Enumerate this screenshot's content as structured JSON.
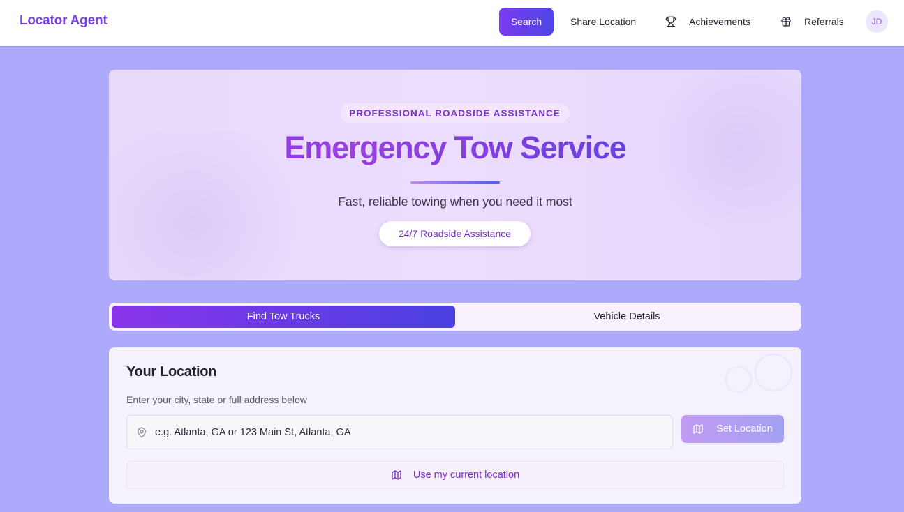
{
  "header": {
    "brand": "Locator Agent",
    "nav": {
      "search": "Search",
      "share_location": "Share Location",
      "achievements": "Achievements",
      "referrals": "Referrals"
    },
    "avatar_initials": "JD"
  },
  "hero": {
    "eyebrow": "PROFESSIONAL ROADSIDE ASSISTANCE",
    "title": "Emergency Tow Service",
    "subtitle": "Fast, reliable towing when you need it most",
    "badge": "24/7 Roadside Assistance"
  },
  "tabs": [
    {
      "label": "Find Tow Trucks",
      "active": true
    },
    {
      "label": "Vehicle Details",
      "active": false
    }
  ],
  "location_card": {
    "title": "Your Location",
    "help": "Enter your city, state or full address below",
    "input_placeholder": "e.g. Atlanta, GA or 123 Main St, Atlanta, GA",
    "input_value": "",
    "set_button": "Set Location",
    "use_current": "Use my current location"
  },
  "icons": {
    "achievements": "trophy-icon",
    "referrals": "gift-icon",
    "input": "map-pin-icon",
    "set_location": "map-icon",
    "use_current": "map-icon"
  },
  "colors": {
    "brand": "#7a3ff0",
    "accent_start": "#7b3bf0",
    "accent_end": "#4f46e5",
    "page_bg": "#aeaafb"
  }
}
